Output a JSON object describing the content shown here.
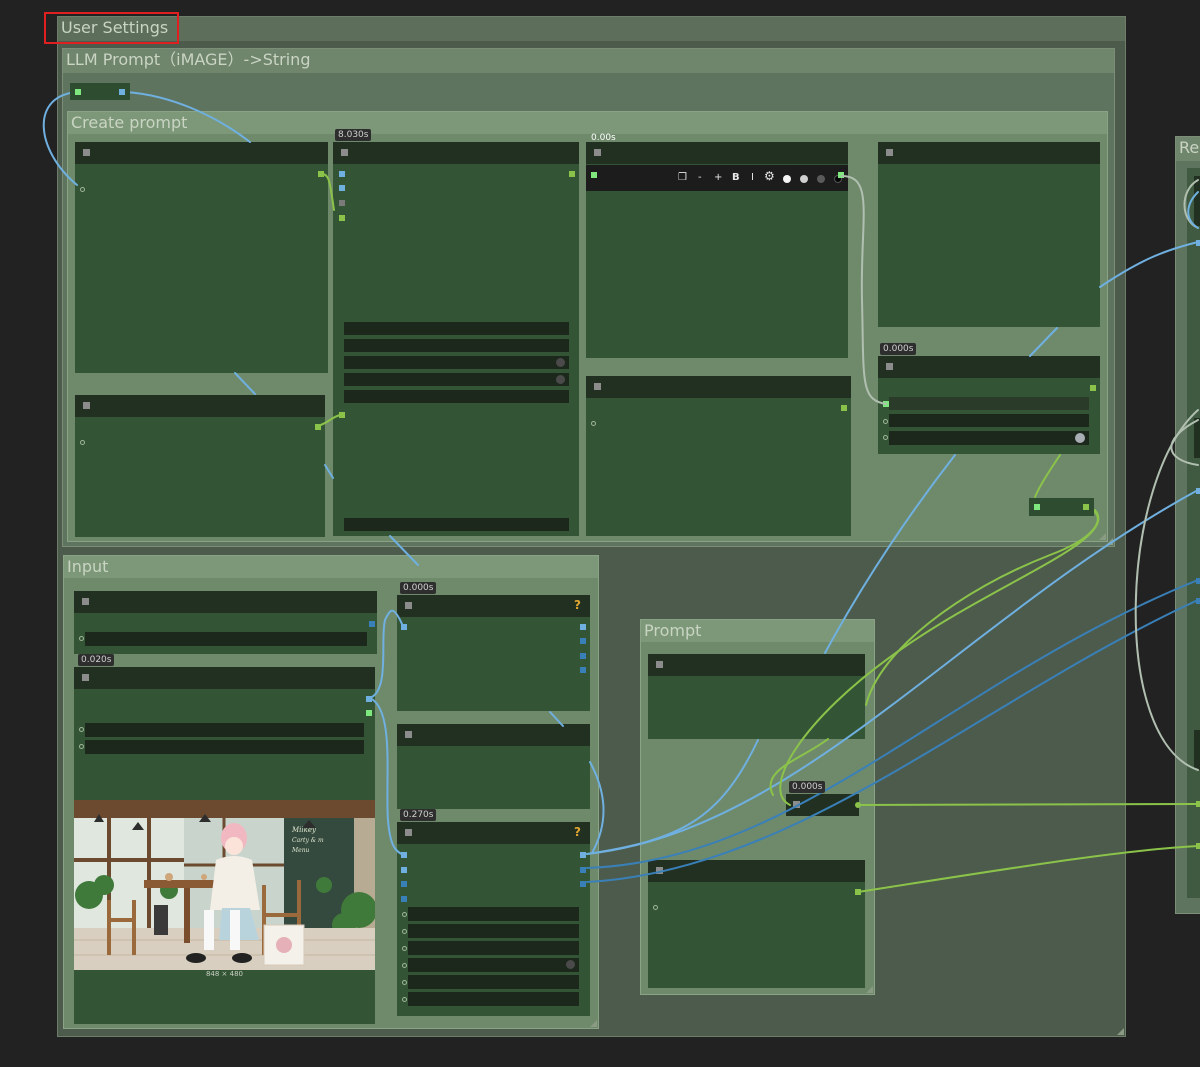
{
  "groups": {
    "user_settings": "User Settings",
    "llm_prompt": "LLM Prompt（iMAGE）->String",
    "create_prompt": "Create prompt",
    "input": "Input",
    "prompt": "Prompt",
    "right_partial": "Re"
  },
  "badges": {
    "node_b": "8.030s",
    "node_c": "0.00s",
    "node_g": "0.000s",
    "input_top": "0.000s",
    "input_load": "0.020s",
    "input_mid": "0.270s",
    "prompt_reroute": "0.000s"
  },
  "toolbar": [
    "❒",
    "-",
    "+",
    "B",
    "I",
    "⚙"
  ],
  "image_preview": {
    "size_label": "848 × 480",
    "sign_lines": [
      "Milkey",
      "Carty & m",
      "Menu"
    ]
  },
  "colors": {
    "canvas": "#222222",
    "node_body": "#345535",
    "node_header": "#213021",
    "group_user": "#4c5b4c",
    "group_llm": "#5f745e",
    "group_create": "#6f8a6b",
    "link_image": "#6fb0e0",
    "link_string": "#8bc34a",
    "link_dark_blue": "#3a80b8",
    "link_grey": "#b0bfb0",
    "highlight": "#e02020"
  }
}
